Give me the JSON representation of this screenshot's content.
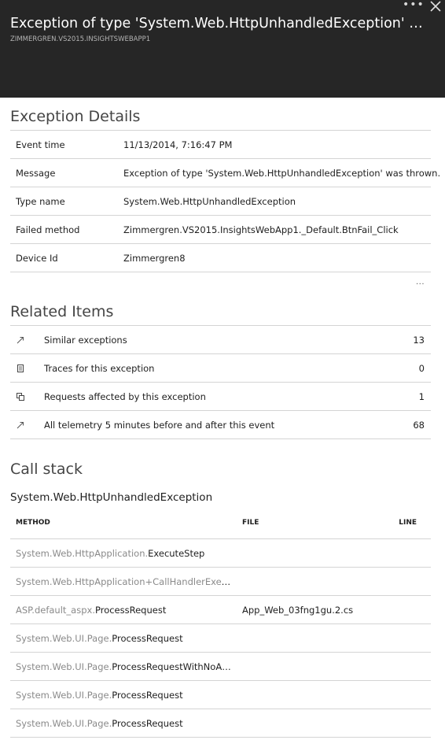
{
  "header": {
    "title": "Exception of type 'System.Web.HttpUnhandledException' was thrown.",
    "subtitle": "ZIMMERGREN.VS2015.INSIGHTSWEBAPP1",
    "more_label": "•••"
  },
  "exception_details": {
    "title": "Exception Details",
    "rows": [
      {
        "key": "Event time",
        "value": "11/13/2014, 7:16:47 PM"
      },
      {
        "key": "Message",
        "value": "Exception of type 'System.Web.HttpUnhandledException' was thrown."
      },
      {
        "key": "Type name",
        "value": "System.Web.HttpUnhandledException"
      },
      {
        "key": "Failed method",
        "value": "Zimmergren.VS2015.InsightsWebApp1._Default.BtnFail_Click"
      },
      {
        "key": "Device Id",
        "value": "Zimmergren8"
      }
    ],
    "more_label": "..."
  },
  "related_items": {
    "title": "Related Items",
    "items": [
      {
        "label": "Similar exceptions",
        "count": "13",
        "icon": "arrow-up-right-icon"
      },
      {
        "label": "Traces for this exception",
        "count": "0",
        "icon": "document-icon"
      },
      {
        "label": "Requests affected by this exception",
        "count": "1",
        "icon": "copy-icon"
      },
      {
        "label": "All telemetry 5 minutes before and after this event",
        "count": "68",
        "icon": "arrow-up-right-icon"
      }
    ]
  },
  "call_stack": {
    "title": "Call stack",
    "exception_type": "System.Web.HttpUnhandledException",
    "columns": {
      "method": "METHOD",
      "file": "FILE",
      "line": "LINE"
    },
    "rows": [
      {
        "ns": "System.Web.HttpApplication.",
        "method": "ExecuteStep",
        "file": ""
      },
      {
        "ns": "System.Web.HttpApplication+CallHandlerExecutionStep.System.Web.HttpApplication.IExecutionStep.Execute",
        "method": "",
        "file": ""
      },
      {
        "ns": "ASP.default_aspx.",
        "method": "ProcessRequest",
        "file": "App_Web_03fng1gu.2.cs"
      },
      {
        "ns": "System.Web.UI.Page.",
        "method": "ProcessRequest",
        "file": ""
      },
      {
        "ns": "System.Web.UI.Page.",
        "method": "ProcessRequestWithNoAssert",
        "file": ""
      },
      {
        "ns": "System.Web.UI.Page.",
        "method": "ProcessRequest",
        "file": ""
      },
      {
        "ns": "System.Web.UI.Page.",
        "method": "ProcessRequest",
        "file": ""
      }
    ]
  }
}
